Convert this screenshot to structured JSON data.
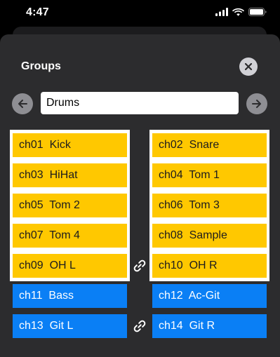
{
  "status_bar": {
    "time": "4:47",
    "icons": [
      "signal-bars",
      "wifi",
      "battery"
    ]
  },
  "sheet": {
    "title": "Groups",
    "close_icon": "close-x",
    "prev_icon": "arrow-left",
    "next_icon": "arrow-right",
    "group_name_value": "Drums",
    "group_name_placeholder": ""
  },
  "colors": {
    "sheet_background": "#2c2c2e",
    "grouped_channel": "#ffc800",
    "ungrouped_channel": "#0a7ff5",
    "group_frame": "#ffffff"
  },
  "channels_left": [
    {
      "label": "ch01  Kick",
      "grouped": true
    },
    {
      "label": "ch03  HiHat",
      "grouped": true
    },
    {
      "label": "ch05  Tom 2",
      "grouped": true
    },
    {
      "label": "ch07  Tom 4",
      "grouped": true
    },
    {
      "label": "ch09  OH L",
      "grouped": true
    },
    {
      "label": "ch11  Bass",
      "grouped": false
    },
    {
      "label": "ch13  Git L",
      "grouped": false
    }
  ],
  "channels_right": [
    {
      "label": "ch02  Snare",
      "grouped": true
    },
    {
      "label": "ch04  Tom 1",
      "grouped": true
    },
    {
      "label": "ch06  Tom 3",
      "grouped": true
    },
    {
      "label": "ch08  Sample",
      "grouped": true
    },
    {
      "label": "ch10  OH R",
      "grouped": true
    },
    {
      "label": "ch12  Ac-Git",
      "grouped": false
    },
    {
      "label": "ch14  Git R",
      "grouped": false
    }
  ],
  "stereo_links": [
    {
      "pair": "ch09-ch10",
      "icon": "link-chain"
    },
    {
      "pair": "ch13-ch14",
      "icon": "link-chain"
    }
  ]
}
